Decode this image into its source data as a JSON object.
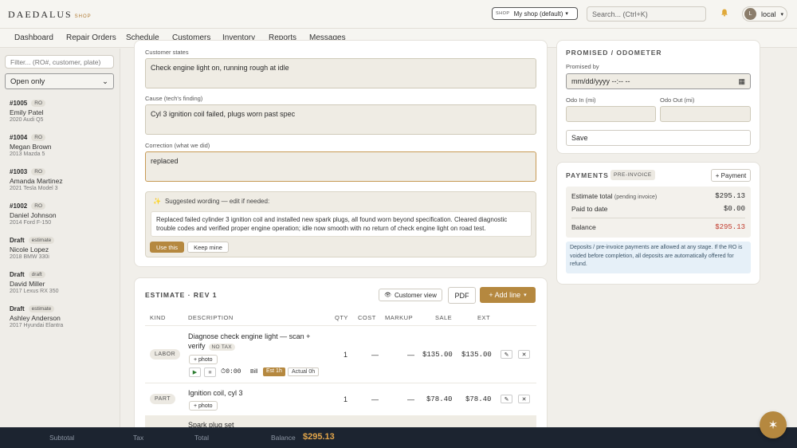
{
  "app": {
    "brand": "DAEDALUS",
    "brand_sub": "SHOP"
  },
  "header": {
    "shop_tag": "SHOP",
    "shop_value": "My shop (default)",
    "search_placeholder": "Search... (Ctrl+K)",
    "user_initial": "L",
    "user_name": "local"
  },
  "nav": [
    "Dashboard",
    "Repair Orders",
    "Schedule",
    "Customers",
    "Inventory",
    "Reports",
    "Messages"
  ],
  "sidebar": {
    "filter_placeholder": "Filter... (RO#, customer, plate)",
    "status_value": "Open only",
    "items": [
      {
        "num": "#1005",
        "badge": "RO",
        "name": "Emily Patel",
        "vehicle": "2020 Audi Q5"
      },
      {
        "num": "#1004",
        "badge": "RO",
        "name": "Megan Brown",
        "vehicle": "2013 Mazda 5"
      },
      {
        "num": "#1003",
        "badge": "RO",
        "name": "Amanda Martinez",
        "vehicle": "2021 Tesla Model 3"
      },
      {
        "num": "#1002",
        "badge": "RO",
        "name": "Daniel Johnson",
        "vehicle": "2014 Ford F-150"
      },
      {
        "num": "Draft",
        "badge": "estimate",
        "name": "Nicole Lopez",
        "vehicle": "2018 BMW 330i"
      },
      {
        "num": "Draft",
        "badge": "draft",
        "name": "David Miller",
        "vehicle": "2017 Lexus RX 350"
      },
      {
        "num": "Draft",
        "badge": "estimate",
        "name": "Ashley Anderson",
        "vehicle": "2017 Hyundai Elantra"
      }
    ]
  },
  "concern": {
    "customer_label": "Customer states",
    "customer_value": "Check engine light on, running rough at idle",
    "cause_label": "Cause (tech's finding)",
    "cause_value": "Cyl 3 ignition coil failed, plugs worn past spec",
    "correction_label": "Correction (what we did)",
    "correction_value": "replaced",
    "suggest_head": "Suggested wording — edit if needed:",
    "suggest_text": "Replaced failed cylinder 3 ignition coil and installed new spark plugs, all found worn beyond specification. Cleared diagnostic trouble codes and verified proper engine operation; idle now smooth with no return of check engine light on road test.",
    "use_label": "Use this",
    "keep_label": "Keep mine"
  },
  "estimate": {
    "title": "ESTIMATE · REV 1",
    "customer_view": "Customer view",
    "pdf": "PDF",
    "add_line": "+ Add line",
    "columns": [
      "KIND",
      "DESCRIPTION",
      "QTY",
      "COST",
      "MARKUP",
      "SALE",
      "EXT"
    ],
    "lines": [
      {
        "kind": "LABOR",
        "desc": "Diagnose check engine light — scan + verify",
        "tag": "NO TAX",
        "photo": "+ photo",
        "qty": "1",
        "cost": "—",
        "markup": "—",
        "sale": "$135.00",
        "ext": "$135.00",
        "timer": "0:00",
        "bill": "Bill",
        "est": "Est 1h",
        "actual": "Actual 0h"
      },
      {
        "kind": "PART",
        "desc": "Ignition coil, cyl 3",
        "photo": "+ photo",
        "qty": "1",
        "cost": "—",
        "markup": "—",
        "sale": "$78.40",
        "ext": "$78.40"
      },
      {
        "desc": "Spark plug set"
      }
    ]
  },
  "promised": {
    "title": "PROMISED / ODOMETER",
    "promised_label": "Promised by",
    "promised_placeholder": "mm/dd/yyyy --:-- --",
    "odo_in_label": "Odo In (mi)",
    "odo_out_label": "Odo Out (mi)",
    "save": "Save"
  },
  "payments": {
    "title": "PAYMENTS",
    "badge": "PRE-INVOICE",
    "add": "+ Payment",
    "estimate_total_label": "Estimate total",
    "estimate_total_note": "(pending invoice)",
    "estimate_total": "$295.13",
    "paid_label": "Paid to date",
    "paid": "$0.00",
    "balance_label": "Balance",
    "balance": "$295.13",
    "note": "Deposits / pre-invoice payments are allowed at any stage. If the RO is voided before completion, all deposits are automatically offered for refund."
  },
  "footer": {
    "subtotal_label": "Subtotal",
    "tax_label": "Tax",
    "total_label": "Total",
    "balance_label": "Balance",
    "balance": "$295.13"
  },
  "colors": {
    "accent": "#b5883f",
    "danger": "#c0392b",
    "footer_bg": "#1c2430"
  }
}
